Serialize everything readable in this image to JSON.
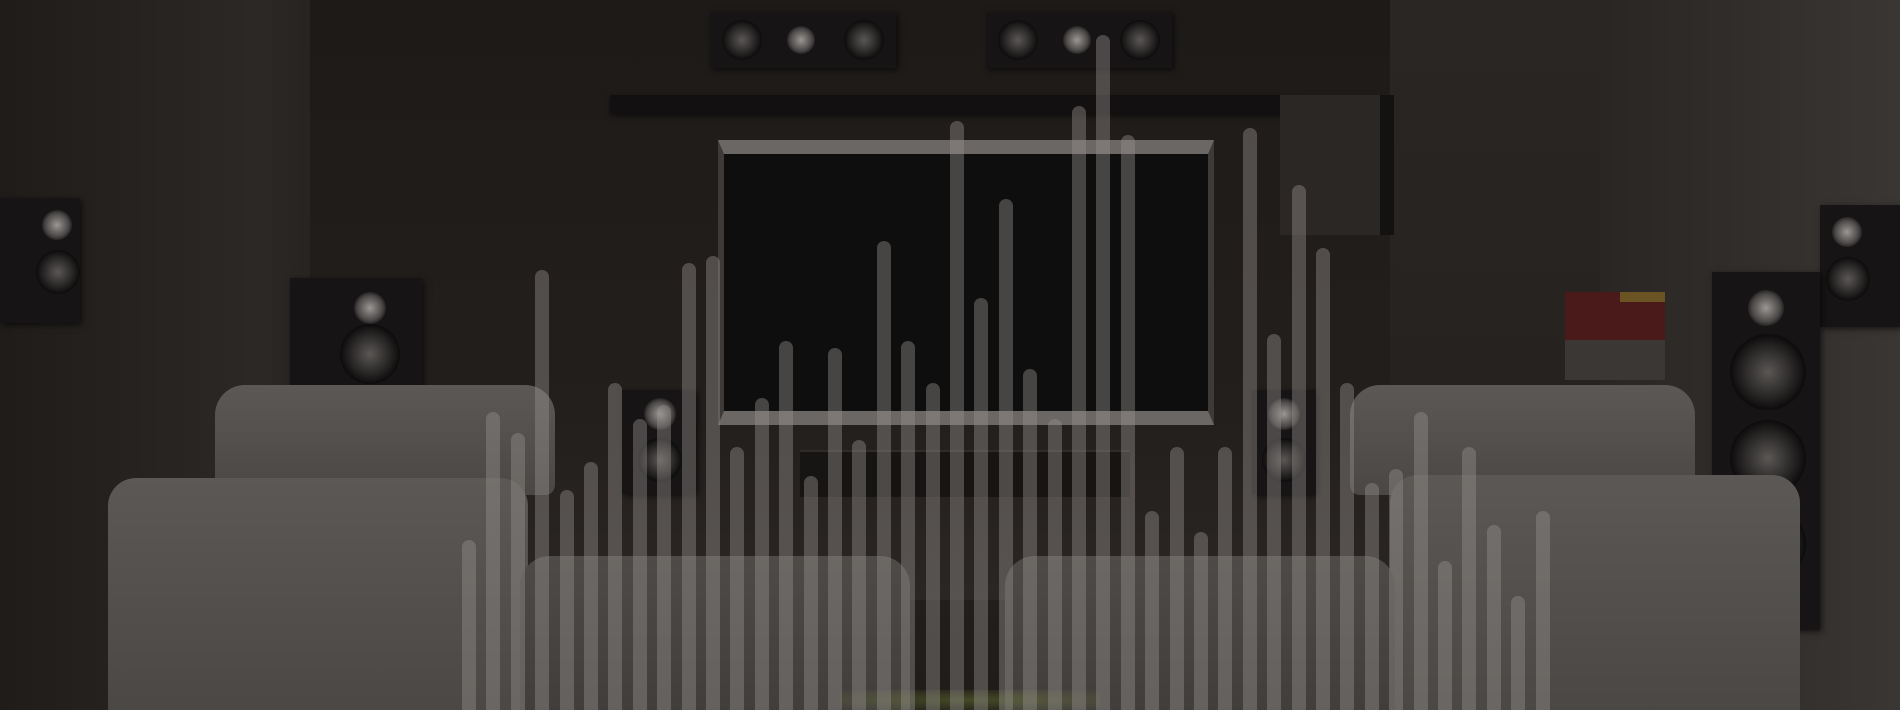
{
  "hero": {
    "background_colors": {
      "wall": "#2a2624",
      "overlay": "#1c1a19",
      "bar": "#96928e"
    },
    "equalizer": {
      "levels": [
        0.24,
        0.42,
        0.39,
        0.62,
        0.31,
        0.35,
        0.46,
        0.41,
        0.43,
        0.63,
        0.64,
        0.37,
        0.44,
        0.52,
        0.33,
        0.51,
        0.38,
        0.66,
        0.52,
        0.46,
        0.83,
        0.58,
        0.72,
        0.48,
        0.41,
        0.85,
        0.95,
        0.81,
        0.28,
        0.37,
        0.25,
        0.37,
        0.82,
        0.53,
        0.74,
        0.65,
        0.46,
        0.32,
        0.34,
        0.42,
        0.21,
        0.37,
        0.26,
        0.16,
        0.28
      ]
    }
  }
}
